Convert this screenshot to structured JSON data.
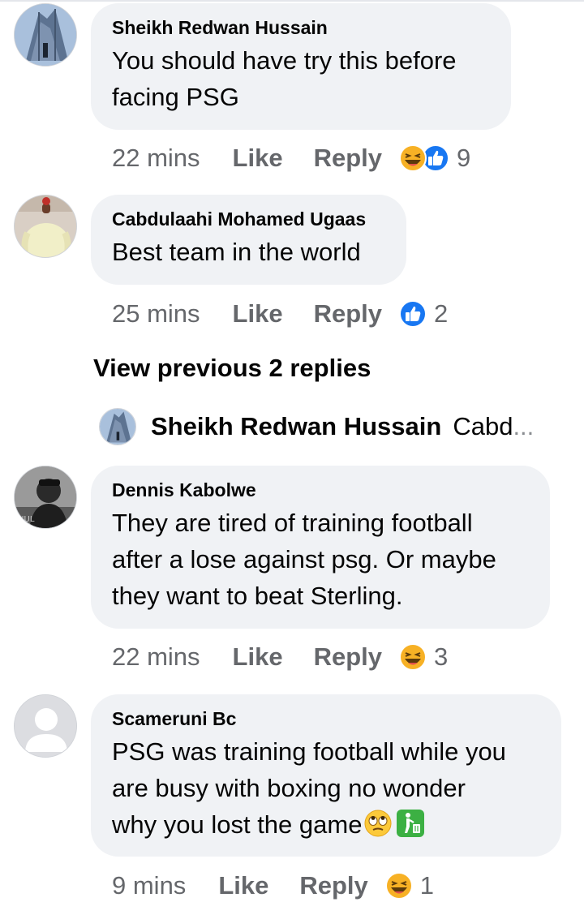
{
  "comments": [
    {
      "author": "Sheikh Redwan Hussain",
      "lines": [
        "You should have try this before",
        "facing PSG"
      ],
      "time": "22 mins",
      "like": "Like",
      "reply": "Reply",
      "reactions": [
        "haha-icon",
        "like-icon"
      ],
      "count": "9"
    },
    {
      "author": "Cabdulaahi Mohamed Ugaas",
      "lines": [
        "Best team in the world"
      ],
      "time": "25 mins",
      "like": "Like",
      "reply": "Reply",
      "reactions": [
        "like-icon"
      ],
      "count": "2"
    },
    {
      "author": "Dennis Kabolwe",
      "lines": [
        "They are tired of training football",
        "after a lose against psg. Or maybe",
        "they want to beat Sterling."
      ],
      "time": "22 mins",
      "like": "Like",
      "reply": "Reply",
      "reactions": [
        "haha-icon"
      ],
      "count": "3"
    },
    {
      "author": "Scameruni Bc",
      "lines": [
        "PSG was training football while you",
        "are busy with boxing no wonder",
        "why you lost the game"
      ],
      "trailing_emoji": [
        "eye-roll-emoji-icon",
        "litter-bin-emoji-icon"
      ],
      "time": "9 mins",
      "like": "Like",
      "reply": "Reply",
      "reactions": [
        "haha-icon"
      ],
      "count": "1"
    }
  ],
  "view_previous": "View previous 2 replies",
  "collapsed_reply": {
    "author": "Sheikh Redwan Hussain",
    "preview": "Cabd",
    "ellipsis": "..."
  },
  "colors": {
    "bubble": "#f0f2f5",
    "meta_text": "#65676b",
    "like_blue": "#1877f2",
    "haha_yellow": "#f7b125"
  }
}
